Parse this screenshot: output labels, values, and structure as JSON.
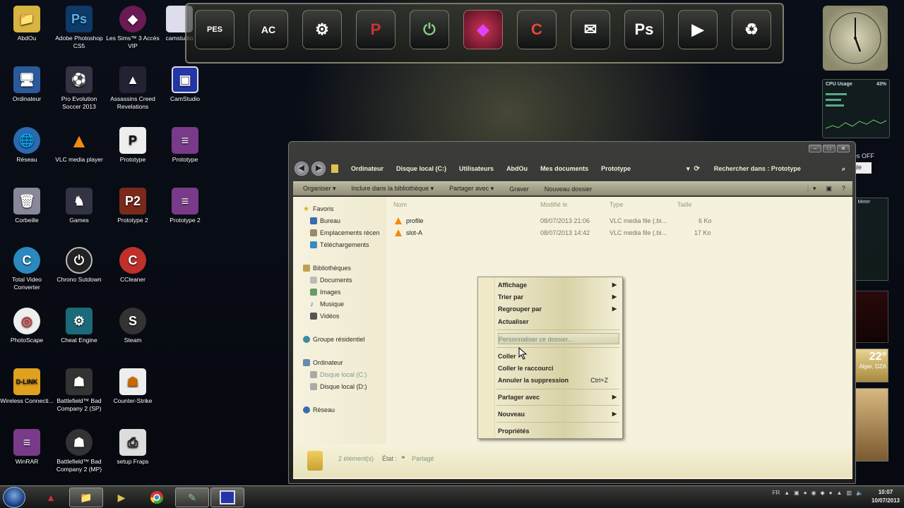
{
  "desktop": {
    "icons": [
      {
        "label": "AbdOu"
      },
      {
        "label": "Adobe Photoshop CS5"
      },
      {
        "label": "Les Sims™ 3 Accès VIP"
      },
      {
        "label": "camstudio"
      },
      {
        "label": "Ordinateur"
      },
      {
        "label": "Pro Evolution Soccer 2013"
      },
      {
        "label": "Assassins Creed Revelations"
      },
      {
        "label": "CamStudio"
      },
      {
        "label": "Réseau"
      },
      {
        "label": "VLC media player"
      },
      {
        "label": "Prototype"
      },
      {
        "label": "Prototype"
      },
      {
        "label": "Corbeille"
      },
      {
        "label": "Games"
      },
      {
        "label": "Prototype 2"
      },
      {
        "label": "Prototype 2"
      },
      {
        "label": "Total Video Converter"
      },
      {
        "label": "Chrono Sutdown"
      },
      {
        "label": "CCleaner"
      },
      {
        "label": "PhotoScape"
      },
      {
        "label": "Cheat Engine"
      },
      {
        "label": "Steam"
      },
      {
        "label": "Wireless Connecti..."
      },
      {
        "label": "Battlefield™ Bad Company 2 (SP)"
      },
      {
        "label": "Counter-Strike"
      },
      {
        "label": "WinRAR"
      },
      {
        "label": "Battlefield™ Bad Company 2 (MP)"
      },
      {
        "label": "setup Fraps"
      }
    ]
  },
  "dock": {
    "items": [
      {
        "label": "PES"
      },
      {
        "label": "AC"
      },
      {
        "label": "⚙"
      },
      {
        "label": "P"
      },
      {
        "label": "⏻"
      },
      {
        "label": "◆"
      },
      {
        "label": "C"
      },
      {
        "label": "✉"
      },
      {
        "label": "Ps"
      },
      {
        "label": "▶"
      },
      {
        "label": "♻"
      }
    ]
  },
  "gadgets": {
    "cpu_title": "CPU Usage",
    "cpu_percent": "43%",
    "weather_temp": "22°",
    "weather_city": "Alger, DZA",
    "partial_text_1": "les OFF",
    "partial_text_2": "gle",
    "partial_text_3": "k Meter"
  },
  "window": {
    "breadcrumbs": [
      "Ordinateur",
      "Disque local (C:)",
      "Utilisateurs",
      "AbdOu",
      "Mes documents",
      "Prototype"
    ],
    "search_placeholder": "Rechercher dans : Prototype",
    "toolbar": {
      "organize": "Organiser ▾",
      "include": "Inclure dans la bibliothèque ▾",
      "share": "Partager avec ▾",
      "burn": "Graver",
      "new_folder": "Nouveau dossier"
    },
    "nav": {
      "favoris": "Favoris",
      "bureau": "Bureau",
      "emplacements": "Emplacements récen",
      "telechargements": "Téléchargements",
      "bibliotheques": "Bibliothèques",
      "documents": "Documents",
      "images": "Images",
      "musique": "Musique",
      "videos": "Vidéos",
      "groupe": "Groupe résidentiel",
      "ordinateur": "Ordinateur",
      "disque_c": "Disque local (C:)",
      "disque_d": "Disque local (D:)",
      "reseau": "Réseau"
    },
    "columns": {
      "name": "Nom",
      "modified": "Modifié le",
      "type": "Type",
      "size": "Taille"
    },
    "files": [
      {
        "name": "profile",
        "modified": "08/07/2013 21:06",
        "type": "VLC media file (.bi...",
        "size": "6 Ko"
      },
      {
        "name": "slot-A",
        "modified": "08/07/2013 14:42",
        "type": "VLC media file (.bi...",
        "size": "17 Ko"
      }
    ],
    "status": {
      "count": "2 élément(s)",
      "state_label": "État :",
      "state_value": "Partagé"
    }
  },
  "context_menu": {
    "affichage": "Affichage",
    "trier": "Trier par",
    "regrouper": "Regrouper par",
    "actualiser": "Actualiser",
    "personnaliser": "Personnaliser ce dossier...",
    "coller": "Coller",
    "coller_raccourci": "Coller le raccourci",
    "annuler": "Annuler la suppression",
    "annuler_shortcut": "Ctrl+Z",
    "partager": "Partager avec",
    "nouveau": "Nouveau",
    "proprietes": "Propriétés"
  },
  "taskbar": {
    "lang": "FR",
    "time": "10:07",
    "date": "10/07/2013"
  },
  "colors": {
    "accent": "#7c9a8c",
    "window_bg": "#f5f1dc"
  }
}
